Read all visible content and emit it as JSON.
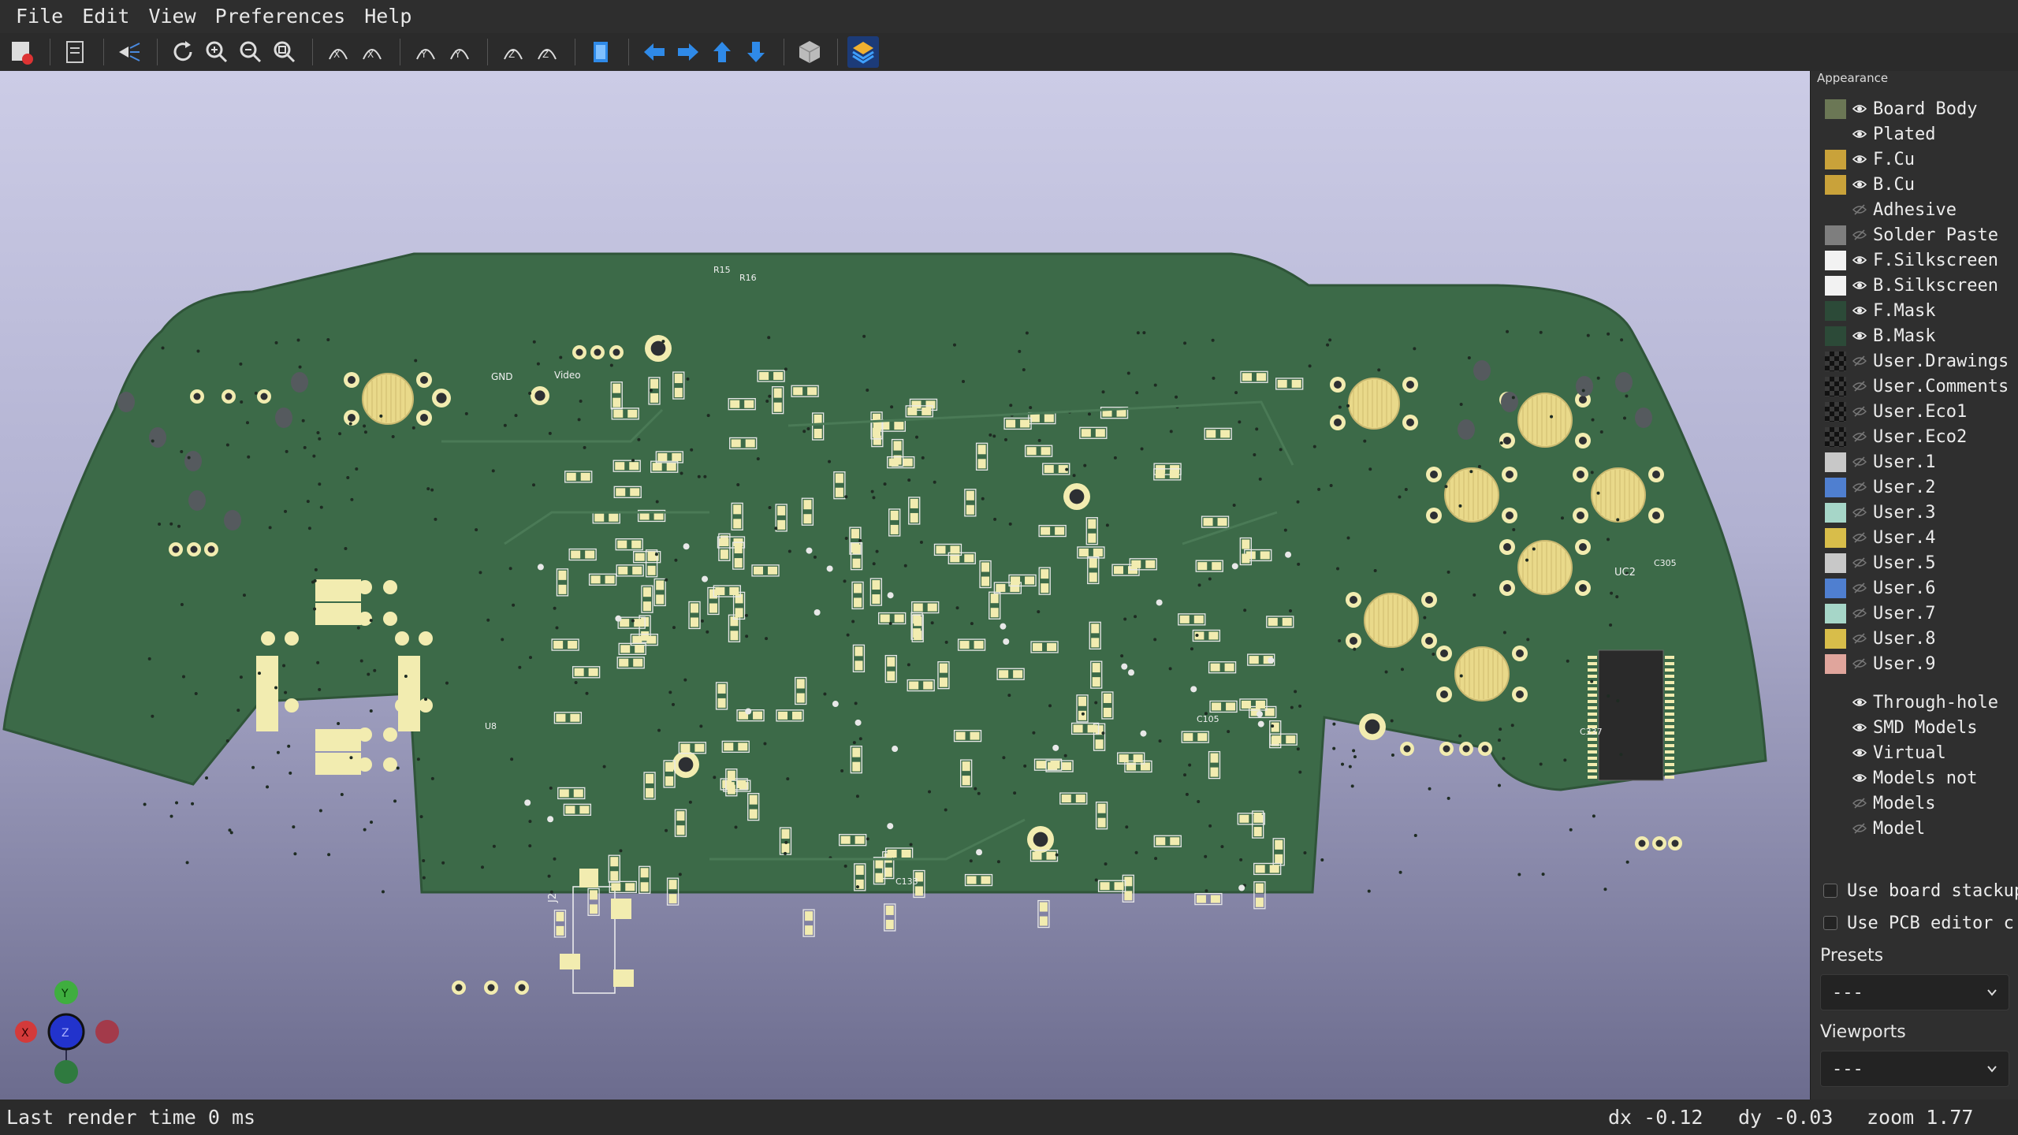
{
  "menu": [
    "File",
    "Edit",
    "View",
    "Preferences",
    "Help"
  ],
  "toolbar": {
    "groups": [
      [
        "export-render-icon"
      ],
      [
        "copy-image-icon"
      ],
      [
        "raytrace-icon"
      ],
      [
        "reload-icon",
        "zoom-in-icon",
        "zoom-out-icon",
        "zoom-fit-icon"
      ],
      [
        "rotate-x-cw-icon",
        "rotate-x-ccw-icon"
      ],
      [
        "rotate-y-cw-icon",
        "rotate-y-ccw-icon"
      ],
      [
        "rotate-z-cw-icon",
        "rotate-z-ccw-icon"
      ],
      [
        "flip-board-icon"
      ],
      [
        "pan-left-icon",
        "pan-right-icon",
        "pan-up-icon",
        "pan-down-icon"
      ],
      [
        "orthographic-icon"
      ],
      [
        "appearance-manager-icon"
      ]
    ]
  },
  "panel": {
    "title": "Appearance",
    "layers": [
      {
        "label": "Board Body",
        "color": "#6b7755",
        "visible": true
      },
      {
        "label": "Plated",
        "color": "",
        "visible": true
      },
      {
        "label": "F.Cu",
        "color": "#c9a23a",
        "visible": true
      },
      {
        "label": "B.Cu",
        "color": "#c9a23a",
        "visible": true
      },
      {
        "label": "Adhesive",
        "color": "",
        "visible": false
      },
      {
        "label": "Solder Paste",
        "color": "#7e7e7e",
        "visible": false
      },
      {
        "label": "F.Silkscreen",
        "color": "#f2f2f2",
        "visible": true
      },
      {
        "label": "B.Silkscreen",
        "color": "#f2f2f2",
        "visible": true
      },
      {
        "label": "F.Mask",
        "color": "#2c4a38",
        "visible": true
      },
      {
        "label": "B.Mask",
        "color": "#2c4a38",
        "visible": true
      },
      {
        "label": "User.Drawings",
        "color": "checker",
        "visible": false
      },
      {
        "label": "User.Comments",
        "color": "checker",
        "visible": false
      },
      {
        "label": "User.Eco1",
        "color": "checker",
        "visible": false
      },
      {
        "label": "User.Eco2",
        "color": "checker",
        "visible": false
      },
      {
        "label": "User.1",
        "color": "#c8c8c8",
        "visible": false
      },
      {
        "label": "User.2",
        "color": "#4f7fd0",
        "visible": false
      },
      {
        "label": "User.3",
        "color": "#a6d6c8",
        "visible": false
      },
      {
        "label": "User.4",
        "color": "#d8bd4a",
        "visible": false
      },
      {
        "label": "User.5",
        "color": "#c8c8c8",
        "visible": false
      },
      {
        "label": "User.6",
        "color": "#4f7fd0",
        "visible": false
      },
      {
        "label": "User.7",
        "color": "#a6d6c8",
        "visible": false
      },
      {
        "label": "User.8",
        "color": "#d8bd4a",
        "visible": false
      },
      {
        "label": "User.9",
        "color": "#e0a59c",
        "visible": false
      }
    ],
    "models": [
      {
        "label": "Through-hole",
        "visible": true
      },
      {
        "label": "SMD Models",
        "visible": true
      },
      {
        "label": "Virtual",
        "visible": true
      },
      {
        "label": "Models not",
        "visible": true
      },
      {
        "label": "Models",
        "visible": false
      },
      {
        "label": "Model",
        "visible": false
      }
    ],
    "options": [
      "Use board stackup",
      "Use PCB editor c"
    ],
    "presets_label": "Presets",
    "presets_value": "---",
    "viewports_label": "Viewports",
    "viewports_value": "---"
  },
  "board_labels": [
    "GND",
    "Video",
    "UC2",
    "C305",
    "C337",
    "J2",
    "U8",
    "R15",
    "R16",
    "C133",
    "C105"
  ],
  "axes": {
    "x": "X",
    "y": "Y",
    "z": "Z"
  },
  "status": {
    "render": "Last render time 0 ms",
    "dx": "dx -0.12",
    "dy": "dy -0.03",
    "zoom": "zoom 1.77"
  }
}
